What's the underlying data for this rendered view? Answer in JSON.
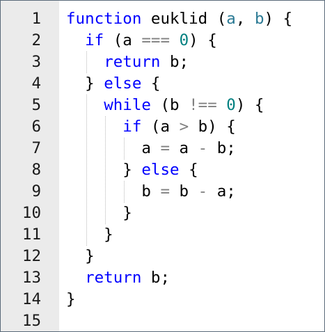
{
  "colors": {
    "keyword": "#0000ff",
    "identifier": "#000000",
    "parameter": "#2b7a94",
    "number": "#008080",
    "operator": "#808080",
    "line_number": "#1a1a1a",
    "gutter_bg": "#ebebeb"
  },
  "editor": {
    "lines": [
      {
        "number": "1",
        "tokens": [
          {
            "t": "function",
            "k": "keyword"
          },
          {
            "t": " euklid ",
            "k": "identifier"
          },
          {
            "t": "(",
            "k": "identifier"
          },
          {
            "t": "a",
            "k": "parameter"
          },
          {
            "t": ", ",
            "k": "identifier"
          },
          {
            "t": "b",
            "k": "parameter"
          },
          {
            "t": ") {",
            "k": "identifier"
          }
        ]
      },
      {
        "number": "2",
        "tokens": [
          {
            "t": "  ",
            "k": "identifier"
          },
          {
            "t": "if",
            "k": "keyword"
          },
          {
            "t": " (a ",
            "k": "identifier"
          },
          {
            "t": "===",
            "k": "operator"
          },
          {
            "t": " ",
            "k": "identifier"
          },
          {
            "t": "0",
            "k": "number"
          },
          {
            "t": ") {",
            "k": "identifier"
          }
        ]
      },
      {
        "number": "3",
        "tokens": [
          {
            "t": "    ",
            "k": "identifier"
          },
          {
            "t": "return",
            "k": "keyword"
          },
          {
            "t": " b;",
            "k": "identifier"
          }
        ]
      },
      {
        "number": "4",
        "tokens": [
          {
            "t": "  } ",
            "k": "identifier"
          },
          {
            "t": "else",
            "k": "keyword"
          },
          {
            "t": " {",
            "k": "identifier"
          }
        ]
      },
      {
        "number": "5",
        "tokens": [
          {
            "t": "    ",
            "k": "identifier"
          },
          {
            "t": "while",
            "k": "keyword"
          },
          {
            "t": " (b ",
            "k": "identifier"
          },
          {
            "t": "!==",
            "k": "operator"
          },
          {
            "t": " ",
            "k": "identifier"
          },
          {
            "t": "0",
            "k": "number"
          },
          {
            "t": ") {",
            "k": "identifier"
          }
        ]
      },
      {
        "number": "6",
        "tokens": [
          {
            "t": "      ",
            "k": "identifier"
          },
          {
            "t": "if",
            "k": "keyword"
          },
          {
            "t": " (a ",
            "k": "identifier"
          },
          {
            "t": ">",
            "k": "operator"
          },
          {
            "t": " b) {",
            "k": "identifier"
          }
        ]
      },
      {
        "number": "7",
        "tokens": [
          {
            "t": "        a ",
            "k": "identifier"
          },
          {
            "t": "=",
            "k": "operator"
          },
          {
            "t": " a ",
            "k": "identifier"
          },
          {
            "t": "-",
            "k": "operator"
          },
          {
            "t": " b;",
            "k": "identifier"
          }
        ]
      },
      {
        "number": "8",
        "tokens": [
          {
            "t": "      } ",
            "k": "identifier"
          },
          {
            "t": "else",
            "k": "keyword"
          },
          {
            "t": " {",
            "k": "identifier"
          }
        ]
      },
      {
        "number": "9",
        "tokens": [
          {
            "t": "        b ",
            "k": "identifier"
          },
          {
            "t": "=",
            "k": "operator"
          },
          {
            "t": " b ",
            "k": "identifier"
          },
          {
            "t": "-",
            "k": "operator"
          },
          {
            "t": " a;",
            "k": "identifier"
          }
        ]
      },
      {
        "number": "10",
        "tokens": [
          {
            "t": "      }",
            "k": "identifier"
          }
        ]
      },
      {
        "number": "11",
        "tokens": [
          {
            "t": "    }",
            "k": "identifier"
          }
        ]
      },
      {
        "number": "12",
        "tokens": [
          {
            "t": "  }",
            "k": "identifier"
          }
        ]
      },
      {
        "number": "13",
        "tokens": [
          {
            "t": "  ",
            "k": "identifier"
          },
          {
            "t": "return",
            "k": "keyword"
          },
          {
            "t": " b;",
            "k": "identifier"
          }
        ]
      },
      {
        "number": "14",
        "tokens": [
          {
            "t": "}",
            "k": "identifier"
          }
        ]
      },
      {
        "number": "15",
        "tokens": []
      }
    ]
  }
}
